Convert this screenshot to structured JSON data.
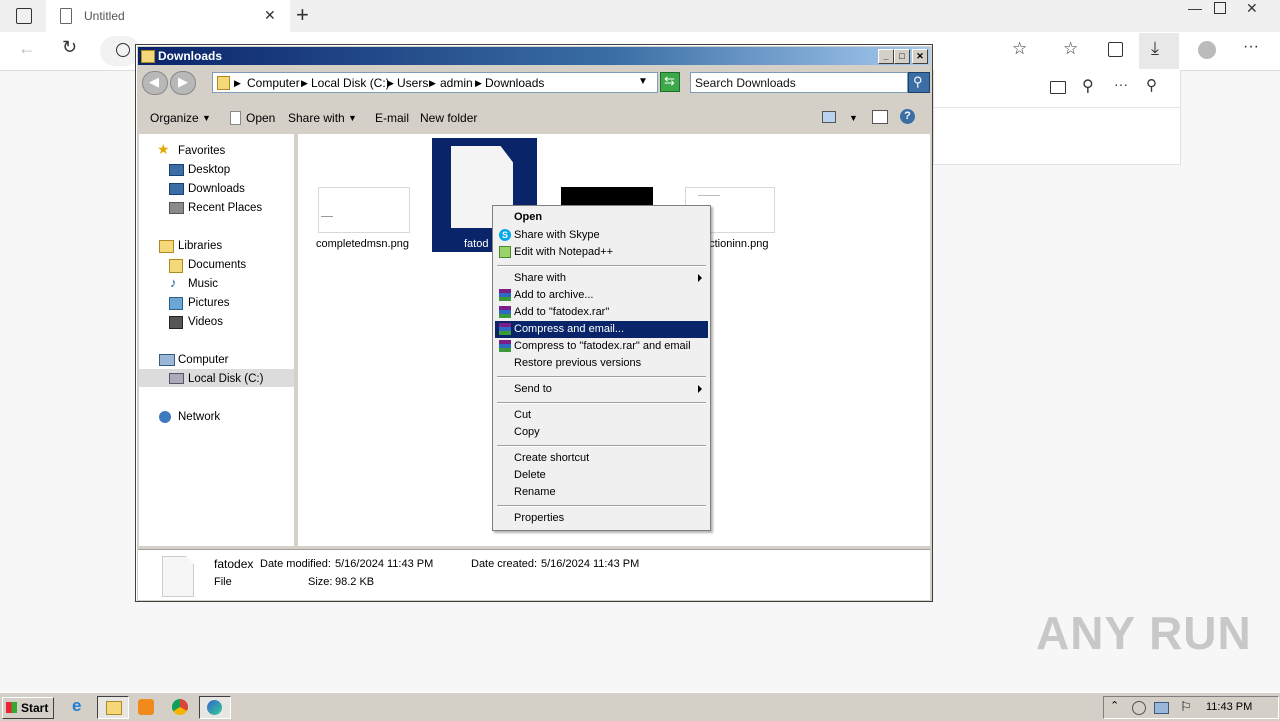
{
  "browser": {
    "tab_title": "Untitled"
  },
  "explorer": {
    "title": "Downloads",
    "breadcrumbs": [
      "Computer",
      "Local Disk (C:)",
      "Users",
      "admin",
      "Downloads"
    ],
    "search_placeholder": "Search Downloads",
    "toolbar": {
      "organize": "Organize",
      "open": "Open",
      "share_with": "Share with",
      "email": "E-mail",
      "new_folder": "New folder"
    },
    "nav": {
      "favorites": "Favorites",
      "desktop": "Desktop",
      "downloads": "Downloads",
      "recent": "Recent Places",
      "libraries": "Libraries",
      "documents": "Documents",
      "music": "Music",
      "pictures": "Pictures",
      "videos": "Videos",
      "computer": "Computer",
      "local_disk": "Local Disk (C:)",
      "network": "Network"
    },
    "files": [
      {
        "name": "completedmsn.png"
      },
      {
        "name": "fatod"
      },
      {
        "name": ""
      },
      {
        "name": "uctioninn.png"
      }
    ],
    "details": {
      "name": "fatodex",
      "type": "File",
      "modified_label": "Date modified:",
      "modified": "5/16/2024 11:43 PM",
      "created_label": "Date created:",
      "created": "5/16/2024 11:43 PM",
      "size_label": "Size:",
      "size": "98.2 KB"
    }
  },
  "context_menu": {
    "open": "Open",
    "share_skype": "Share with Skype",
    "edit_notepad": "Edit with Notepad++",
    "share_with": "Share with",
    "add_archive": "Add to archive...",
    "add_rar": "Add to \"fatodex.rar\"",
    "compress_email": "Compress and email...",
    "compress_rar_email": "Compress to \"fatodex.rar\" and email",
    "restore": "Restore previous versions",
    "send_to": "Send to",
    "cut": "Cut",
    "copy": "Copy",
    "create_shortcut": "Create shortcut",
    "delete": "Delete",
    "rename": "Rename",
    "properties": "Properties"
  },
  "taskbar": {
    "start": "Start",
    "clock": "11:43 PM"
  },
  "watermark": "ANY RUN",
  "colors": {
    "selection": "#0a246a",
    "window_face": "#d4d0c8"
  }
}
